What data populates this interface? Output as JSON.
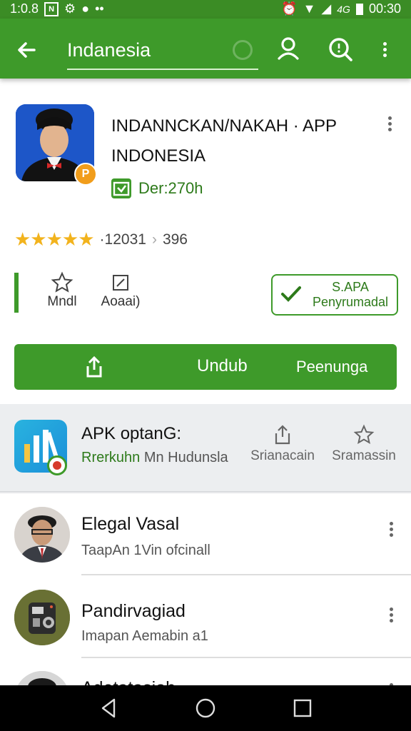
{
  "status_bar": {
    "time_left": "1:0.8",
    "time_right": "00:30",
    "signal_label": "4G"
  },
  "app_bar": {
    "search_value": "Indanesia"
  },
  "app": {
    "title_line1": "INDANNCKAN/NAKAH · APP",
    "title_line2": "INDONESIA",
    "developer": "Der:270h",
    "icon_badge": "P",
    "rating_count": "·12031",
    "downloads": "396"
  },
  "actions": {
    "wishlist_label": "Mndl",
    "report_label": "Aoaai)",
    "outline_line1": "S.APA",
    "outline_line2": "Penyrumadal",
    "primary_label": "Undub",
    "primary_secondary": "Peenunga"
  },
  "promo": {
    "title": "APK optanG:",
    "sub_highlight": "Rrerkuhn",
    "sub_rest": "Mn Hudunsla",
    "action1": "Srianacain",
    "action2": "Sramassin"
  },
  "list": [
    {
      "title": "Elegal Vasal",
      "subtitle": "TaapAn 1Vin ofcinall"
    },
    {
      "title": "Pandirvagiad",
      "subtitle": "Imapan Aemabin a1"
    },
    {
      "title": "Adetatasiah",
      "subtitle": ""
    }
  ],
  "colors": {
    "accent": "#3e9a2a",
    "accent_dark": "#2d7a1a",
    "star": "#f2b31d"
  }
}
